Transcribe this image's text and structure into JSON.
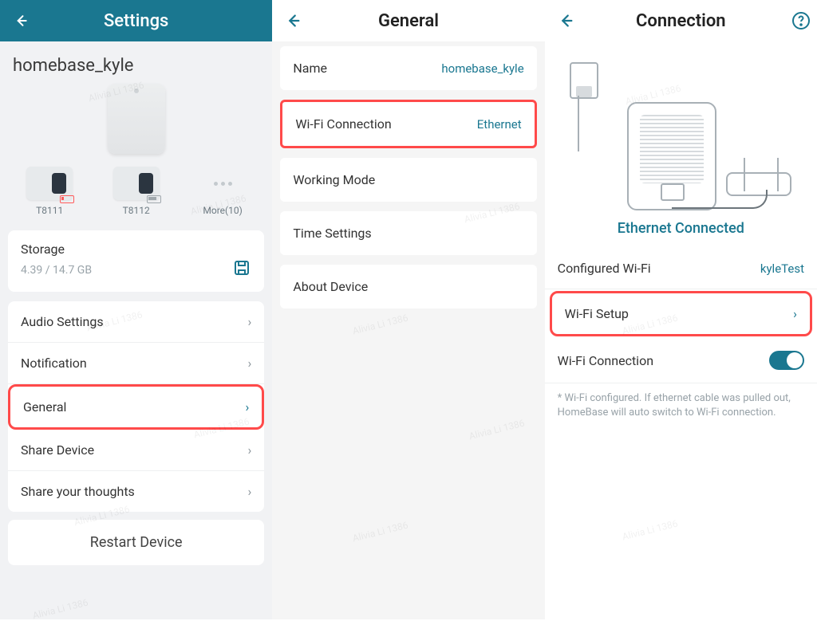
{
  "watermark": "Alivia Li 1386",
  "left": {
    "header_title": "Settings",
    "device_name": "homebase_kyle",
    "devices": [
      {
        "label": "T8111"
      },
      {
        "label": "T8112"
      }
    ],
    "more_label": "More(10)",
    "storage_label": "Storage",
    "storage_value": "4.39 / 14.7 GB",
    "rows": {
      "audio": "Audio Settings",
      "notification": "Notification",
      "general": "General",
      "share_device": "Share Device",
      "share_thoughts": "Share your thoughts"
    },
    "restart": "Restart Device"
  },
  "mid": {
    "header_title": "General",
    "rows": {
      "name_label": "Name",
      "name_value": "homebase_kyle",
      "wifi_label": "Wi-Fi Connection",
      "wifi_value": "Ethernet",
      "working_mode": "Working Mode",
      "time_settings": "Time Settings",
      "about_device": "About Device"
    }
  },
  "right": {
    "header_title": "Connection",
    "eth_status": "Ethernet Connected",
    "configured_wifi_label": "Configured Wi-Fi",
    "configured_wifi_value": "kyleTest",
    "wifi_setup_label": "Wi-Fi Setup",
    "wifi_conn_label": "Wi-Fi Connection",
    "footnote": "* Wi-Fi configured. If ethernet cable was pulled out, HomeBase will auto switch to Wi-Fi connection."
  }
}
